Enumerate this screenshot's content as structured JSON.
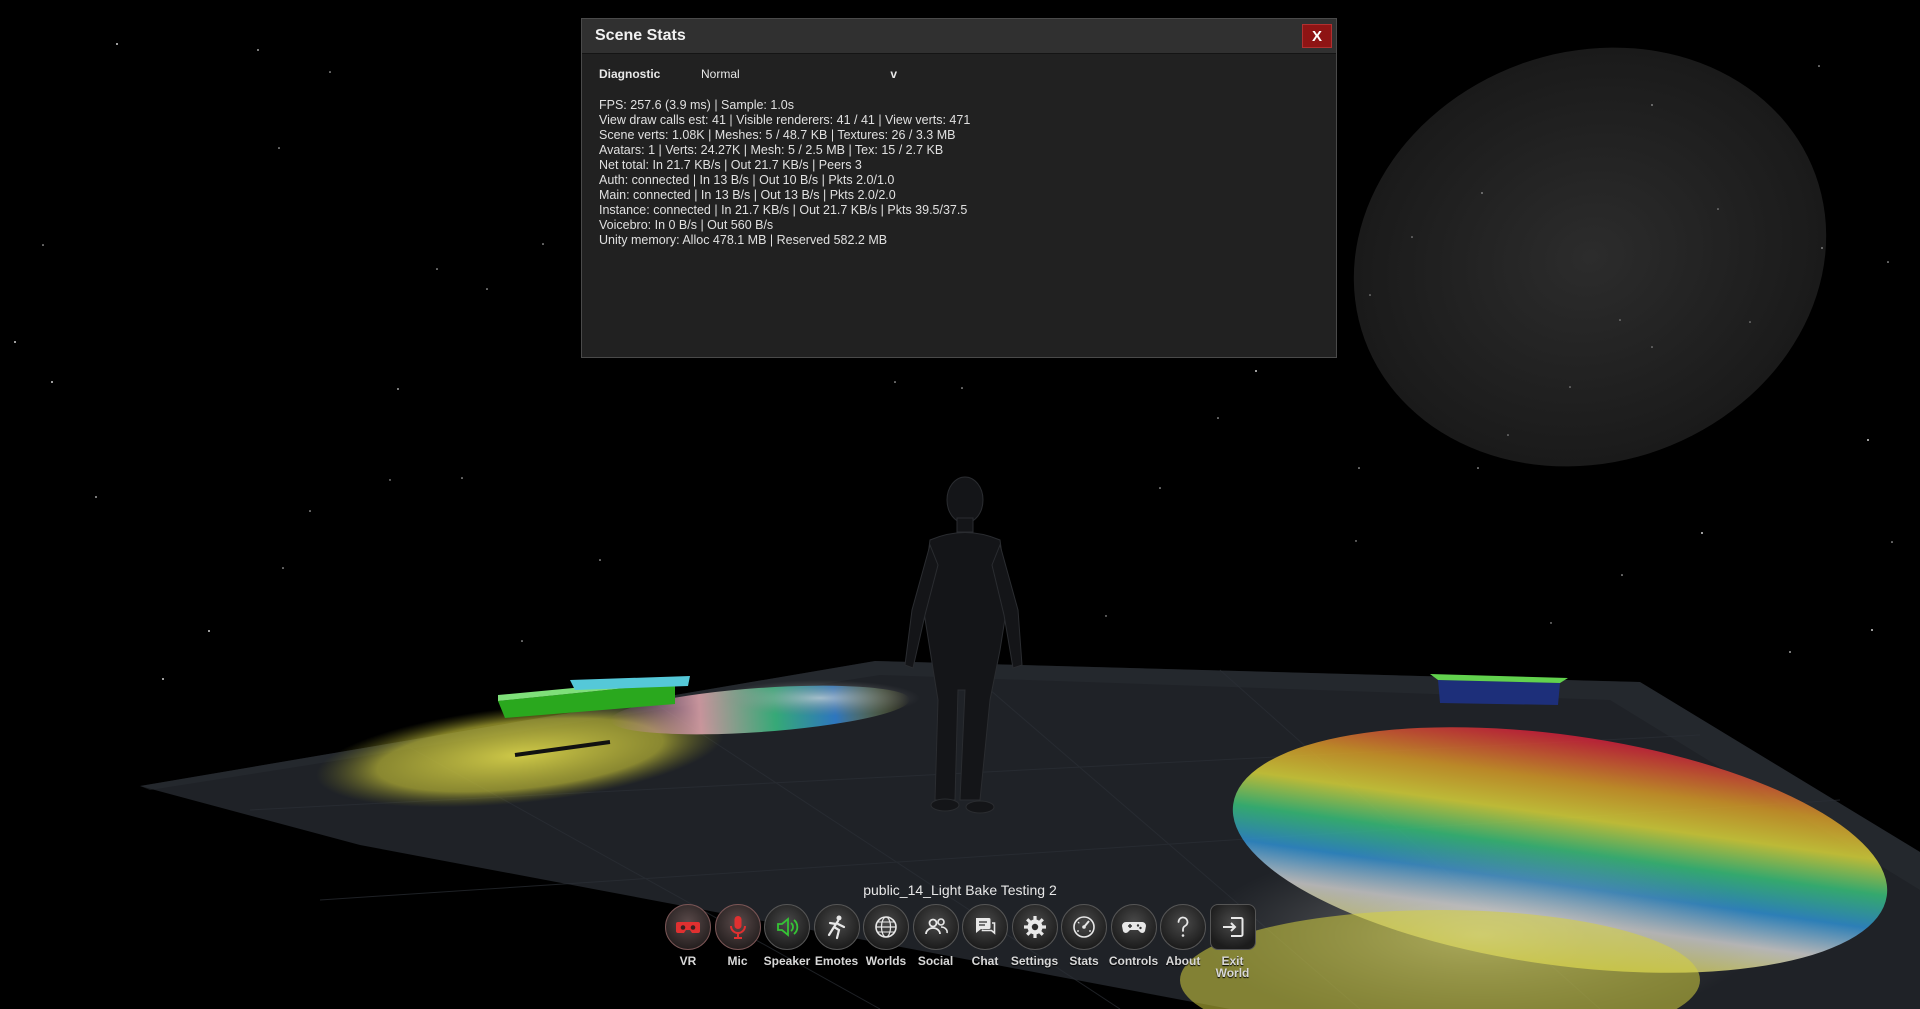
{
  "scene_stats": {
    "title": "Scene Stats",
    "close_label": "X",
    "diagnostic_label": "Diagnostic",
    "diagnostic_value": "Normal",
    "diagnostic_chevron": "v",
    "lines": [
      "FPS: 257.6 (3.9 ms)  |  Sample: 1.0s",
      "View draw calls est: 41  |  Visible renderers: 41 / 41  |  View verts: 471",
      "Scene verts: 1.08K  |  Meshes: 5 / 48.7 KB  |  Textures: 26 / 3.3 MB",
      "Avatars: 1  |  Verts: 24.27K  |  Mesh: 5 / 2.5 MB  |  Tex: 15 / 2.7 KB",
      "Net total: In 21.7 KB/s  |  Out 21.7 KB/s  |  Peers 3",
      "Auth: connected  |  In 13 B/s  |  Out 10 B/s  |  Pkts 2.0/1.0",
      "Main: connected  |  In 13 B/s  |  Out 13 B/s  |  Pkts 2.0/2.0",
      "Instance: connected  |  In 21.7 KB/s  |  Out 21.7 KB/s  |  Pkts 39.5/37.5",
      "Voicebro: In 0 B/s  |  Out 560 B/s",
      "Unity memory: Alloc 478.1 MB  |  Reserved 582.2 MB"
    ]
  },
  "world_name": "public_14_Light Bake Testing 2",
  "toolbar": [
    {
      "label": "VR",
      "icon": "vr-headset-icon",
      "color": "#e03030"
    },
    {
      "label": "Mic",
      "icon": "microphone-icon",
      "color": "#e03030"
    },
    {
      "label": "Speaker",
      "icon": "speaker-icon",
      "color": "#35c435"
    },
    {
      "label": "Emotes",
      "icon": "emote-figure-icon",
      "color": "#e8e8e8"
    },
    {
      "label": "Worlds",
      "icon": "globe-icon",
      "color": "#e8e8e8"
    },
    {
      "label": "Social",
      "icon": "people-icon",
      "color": "#e8e8e8"
    },
    {
      "label": "Chat",
      "icon": "chat-bubbles-icon",
      "color": "#e8e8e8"
    },
    {
      "label": "Settings",
      "icon": "gear-icon",
      "color": "#e8e8e8"
    },
    {
      "label": "Stats",
      "icon": "speedometer-icon",
      "color": "#e8e8e8"
    },
    {
      "label": "Controls",
      "icon": "gamepad-icon",
      "color": "#e8e8e8"
    },
    {
      "label": "About",
      "icon": "question-icon",
      "color": "#e8e8e8"
    },
    {
      "label": "Exit\nWorld",
      "icon": "exit-icon",
      "color": "#e8e8e8"
    }
  ]
}
